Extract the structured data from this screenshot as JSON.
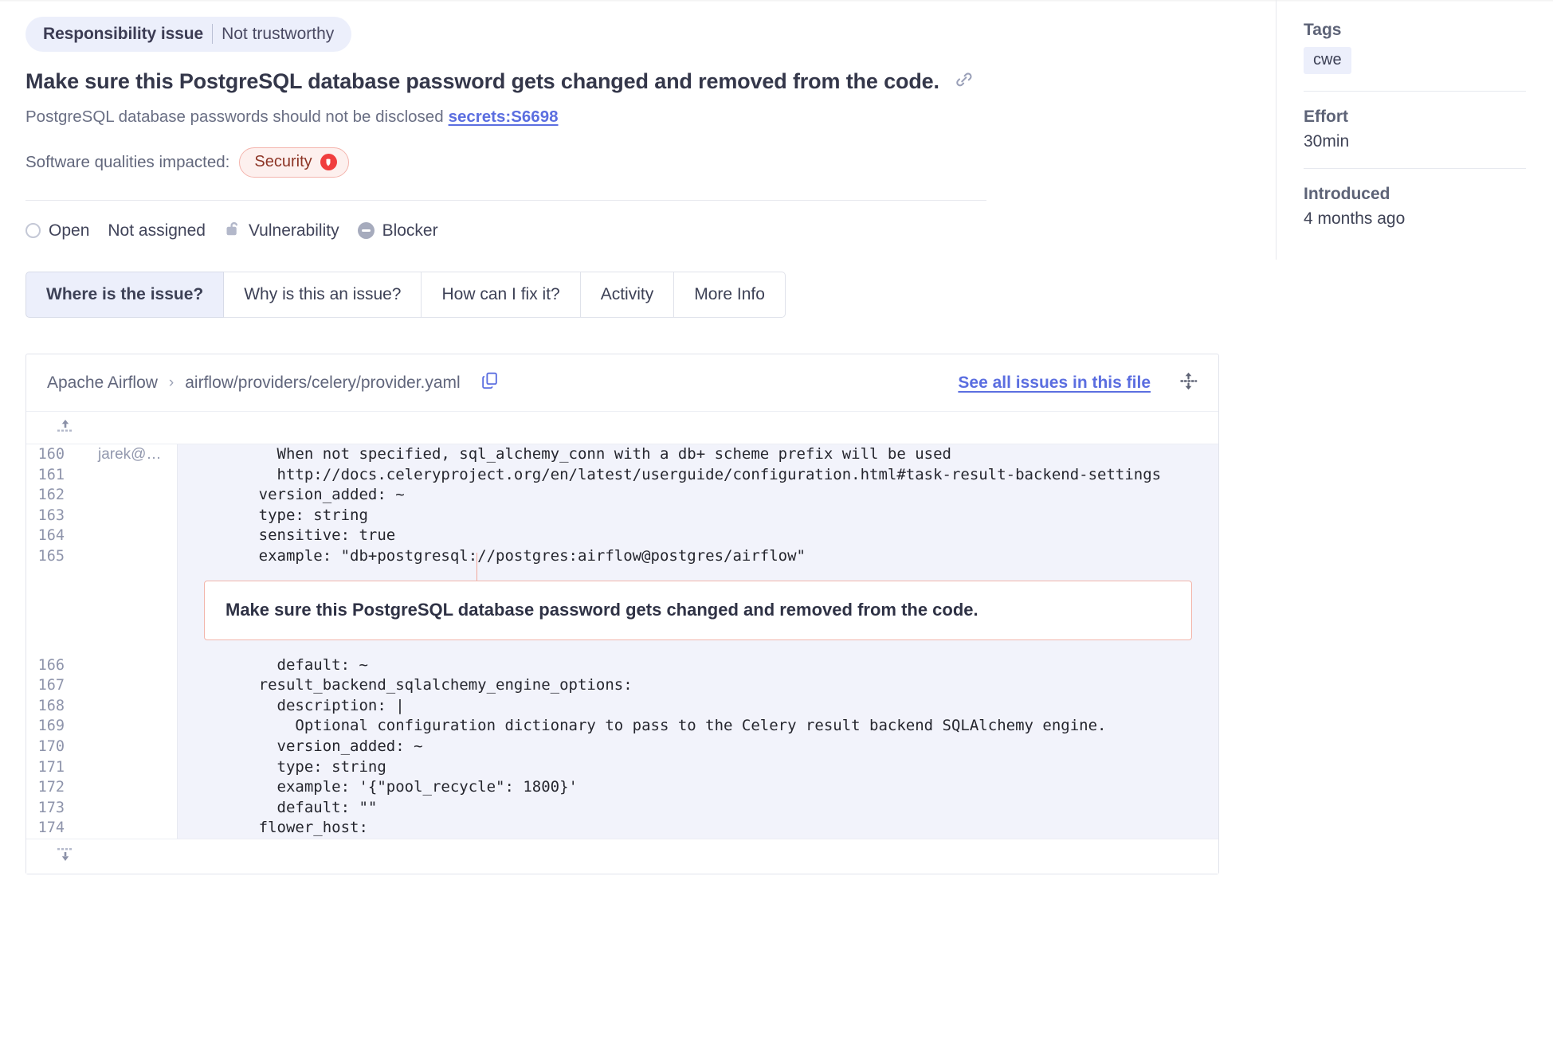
{
  "header": {
    "ribbon_primary": "Responsibility issue",
    "ribbon_secondary": "Not trustworthy",
    "issue_title": "Make sure this PostgreSQL database password gets changed and removed from the code.",
    "rule_text": "PostgreSQL database passwords should not be disclosed",
    "rule_link": "secrets:S6698",
    "qualities_label": "Software qualities impacted:",
    "quality_badge": "Security",
    "link_icon": "link-icon",
    "security_icon": "security-shield-icon"
  },
  "status": {
    "state": "Open",
    "assignee": "Not assigned",
    "type": "Vulnerability",
    "severity": "Blocker",
    "state_icon": "open-circle-icon",
    "type_icon": "open-lock-icon",
    "severity_icon": "blocker-icon"
  },
  "tabs": [
    {
      "label": "Where is the issue?",
      "active": true
    },
    {
      "label": "Why is this an issue?",
      "active": false
    },
    {
      "label": "How can I fix it?",
      "active": false
    },
    {
      "label": "Activity",
      "active": false
    },
    {
      "label": "More Info",
      "active": false
    }
  ],
  "file": {
    "project": "Apache Airflow",
    "separator": "›",
    "path": "airflow/providers/celery/provider.yaml",
    "copy_icon": "copy-icon",
    "see_all_label": "See all issues in this file",
    "resize_icon": "expand-vertical-icon",
    "expand_up_icon": "expand-up-icon",
    "expand_down_icon": "expand-down-icon"
  },
  "code": {
    "author_first_line": "jarek@…",
    "issue_message": "Make sure this PostgreSQL database password gets changed and removed from the code.",
    "lines_before": [
      {
        "num": "160",
        "author": "jarek@…",
        "text": "        When not specified, sql_alchemy_conn with a db+ scheme prefix will be used"
      },
      {
        "num": "161",
        "author": "",
        "text": "        http://docs.celeryproject.org/en/latest/userguide/configuration.html#task-result-backend-settings"
      },
      {
        "num": "162",
        "author": "",
        "text": "      version_added: ~"
      },
      {
        "num": "163",
        "author": "",
        "text": "      type: string"
      },
      {
        "num": "164",
        "author": "",
        "text": "      sensitive: true"
      }
    ],
    "issue_line": {
      "num": "165",
      "author": "",
      "prefix": "      example: \"db+postgresql://postgres:",
      "highlight": "airflow",
      "suffix": "@postgres/airflow\""
    },
    "lines_after": [
      {
        "num": "166",
        "author": "",
        "text": "        default: ~"
      },
      {
        "num": "167",
        "author": "",
        "text": "      result_backend_sqlalchemy_engine_options:"
      },
      {
        "num": "168",
        "author": "",
        "text": "        description: |"
      },
      {
        "num": "169",
        "author": "",
        "text": "          Optional configuration dictionary to pass to the Celery result backend SQLAlchemy engine."
      },
      {
        "num": "170",
        "author": "",
        "text": "        version_added: ~"
      },
      {
        "num": "171",
        "author": "",
        "text": "        type: string"
      },
      {
        "num": "172",
        "author": "",
        "text": "        example: '{\"pool_recycle\": 1800}'"
      },
      {
        "num": "173",
        "author": "",
        "text": "        default: \"\""
      },
      {
        "num": "174",
        "author": "",
        "text": "      flower_host:"
      }
    ]
  },
  "sidebar": {
    "tags_label": "Tags",
    "tag_value": "cwe",
    "effort_label": "Effort",
    "effort_value": "30min",
    "introduced_label": "Introduced",
    "introduced_value": "4 months ago"
  },
  "colors": {
    "accent": "#5b6ee0",
    "security_red": "#f03e3e",
    "callout_border": "#f2b5ab",
    "code_bg": "#f2f3fb",
    "ribbon_bg": "#eceffb"
  }
}
